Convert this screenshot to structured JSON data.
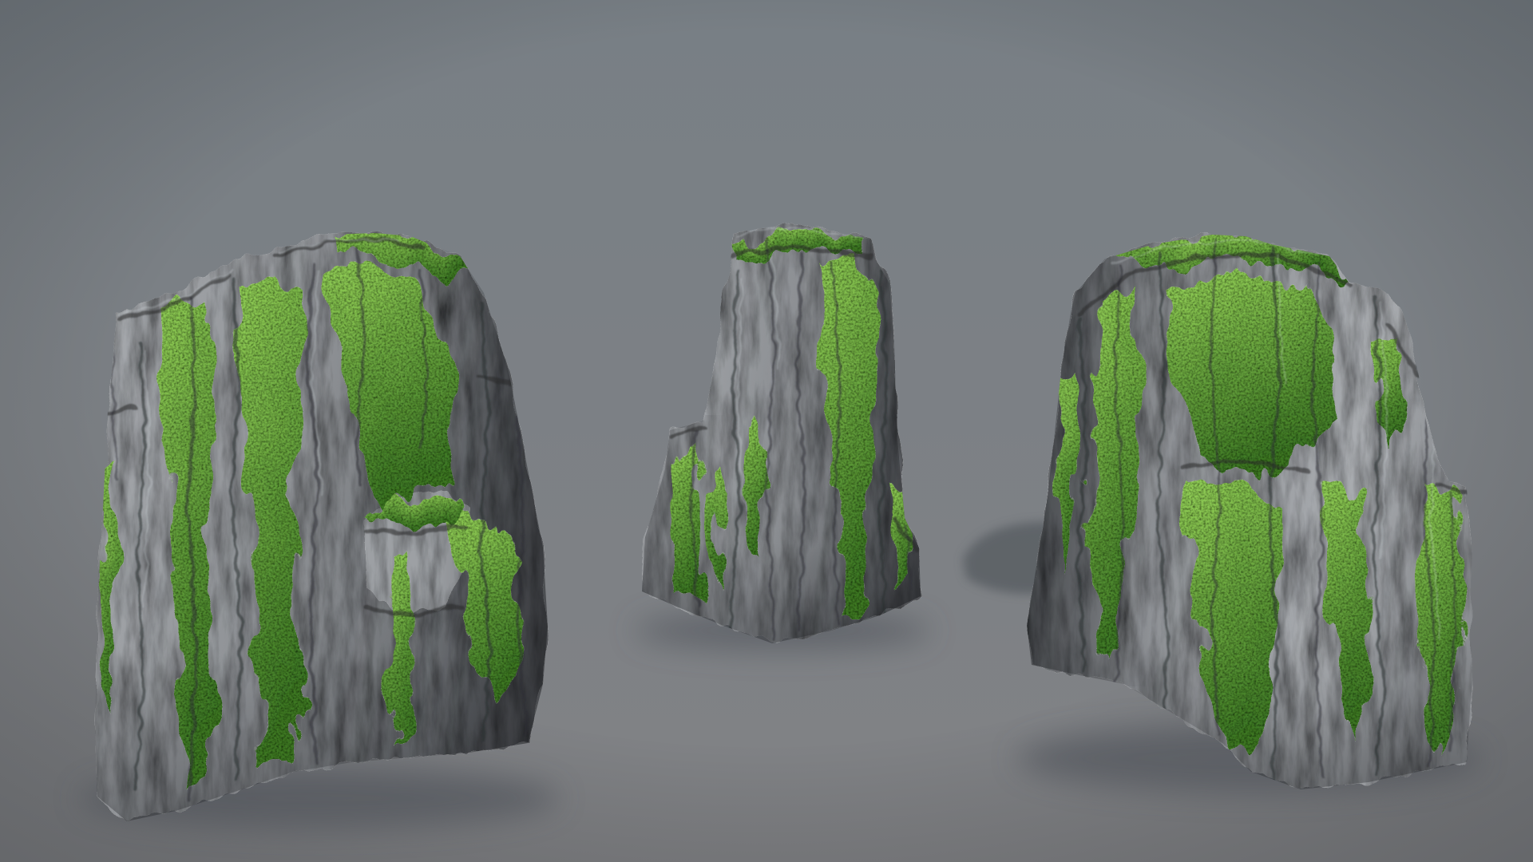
{
  "palette": {
    "background_top": "#787f85",
    "background_bottom": "#818285",
    "rock_light": "#a9acb0",
    "rock_mid": "#8b8e92",
    "rock_dark": "#5e6165",
    "moss_light": "#95d258",
    "moss_dark": "#3d7824",
    "shadow": "#4a4e54"
  }
}
